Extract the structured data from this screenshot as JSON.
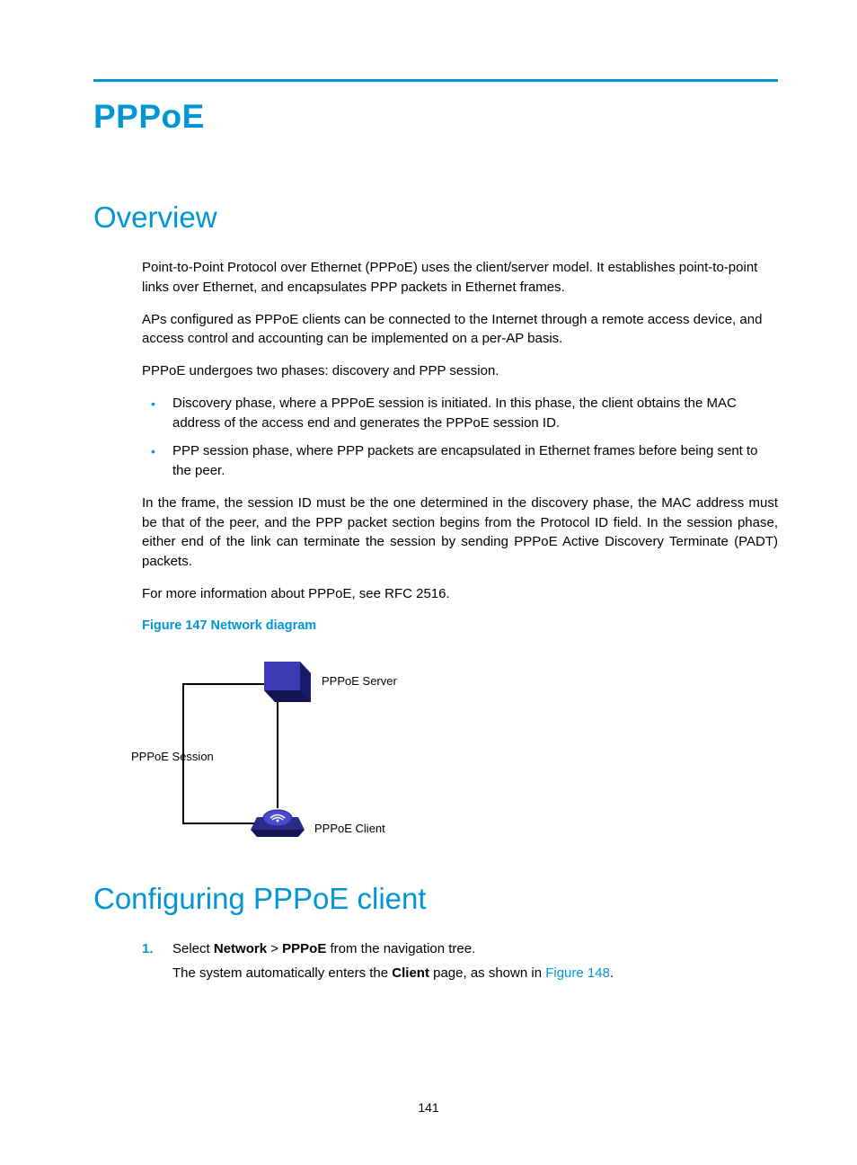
{
  "title": "PPPoE",
  "overview": {
    "heading": "Overview",
    "p1": "Point-to-Point Protocol over Ethernet (PPPoE) uses the client/server model. It establishes point-to-point links over Ethernet, and encapsulates PPP packets in Ethernet frames.",
    "p2": "APs configured as PPPoE clients can be connected to the Internet through a remote access device, and access control and accounting can be implemented on a per-AP basis.",
    "p3": "PPPoE undergoes two phases: discovery and PPP session.",
    "bullets": [
      "Discovery phase, where a PPPoE session is initiated. In this phase, the client obtains the MAC address of the access end and generates the PPPoE session ID.",
      "PPP session phase, where PPP packets are encapsulated in Ethernet frames before being sent to the peer."
    ],
    "p4": "In the frame, the session ID must be the one determined in the discovery phase, the MAC address must be that of the peer, and the PPP packet section begins from the Protocol ID field. In the session phase, either end of the link can terminate the session by sending PPPoE Active Discovery Terminate (PADT) packets.",
    "p5": "For more information about PPPoE, see RFC 2516.",
    "figure_caption": "Figure 147 Network diagram",
    "diagram": {
      "server": "PPPoE Server",
      "session": "PPPoE Session",
      "client": "PPPoE Client"
    }
  },
  "config": {
    "heading": "Configuring PPPoE client",
    "step1_num": "1.",
    "step1_a": "Select ",
    "step1_b": "Network",
    "step1_c": " > ",
    "step1_d": "PPPoE",
    "step1_e": " from the navigation tree.",
    "step1_sub_a": "The system automatically enters the ",
    "step1_sub_b": "Client",
    "step1_sub_c": " page, as shown in ",
    "step1_link": "Figure 148",
    "step1_sub_d": "."
  },
  "page_number": "141"
}
